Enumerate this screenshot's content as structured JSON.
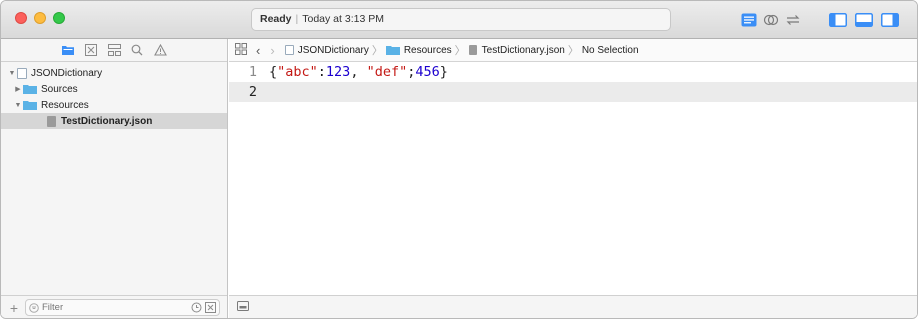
{
  "window": {
    "status": "Ready",
    "timestamp": "Today at 3:13 PM"
  },
  "toolbar": {
    "right_icons": [
      "standard-editor-icon",
      "assistant-editor-icon",
      "version-editor-icon",
      "navigator-toggle-icon",
      "debug-area-toggle-icon",
      "utilities-toggle-icon"
    ]
  },
  "navigator": {
    "tab_icons": [
      "project-navigator-icon",
      "symbol-navigator-icon",
      "hierarchy-navigator-icon",
      "find-navigator-icon",
      "issue-navigator-icon"
    ],
    "tree": [
      {
        "label": "JSONDictionary",
        "type": "project",
        "expanded": true,
        "indent": 0
      },
      {
        "label": "Sources",
        "type": "folder",
        "expanded": false,
        "indent": 1
      },
      {
        "label": "Resources",
        "type": "folder",
        "expanded": true,
        "indent": 1
      },
      {
        "label": "TestDictionary.json",
        "type": "file",
        "selected": true,
        "indent": 2
      }
    ],
    "filter_placeholder": "Filter"
  },
  "jumpbar": {
    "crumbs": [
      "JSONDictionary",
      "Resources",
      "TestDictionary.json",
      "No Selection"
    ]
  },
  "editor": {
    "lines": [
      {
        "number": "1",
        "tokens": [
          {
            "t": "{",
            "k": "punct"
          },
          {
            "t": "\"abc\"",
            "k": "str"
          },
          {
            "t": ":",
            "k": "punct"
          },
          {
            "t": "123",
            "k": "num"
          },
          {
            "t": ", ",
            "k": "punct"
          },
          {
            "t": "\"def\"",
            "k": "str"
          },
          {
            "t": ";",
            "k": "punct"
          },
          {
            "t": "456",
            "k": "num"
          },
          {
            "t": "}",
            "k": "punct"
          }
        ]
      },
      {
        "number": "2",
        "tokens": []
      }
    ],
    "current_line": 2
  },
  "colors": {
    "string": "#c41a16",
    "number": "#1c00cf",
    "folder": "#5ab2e6",
    "selection": "#d6d6d6"
  }
}
